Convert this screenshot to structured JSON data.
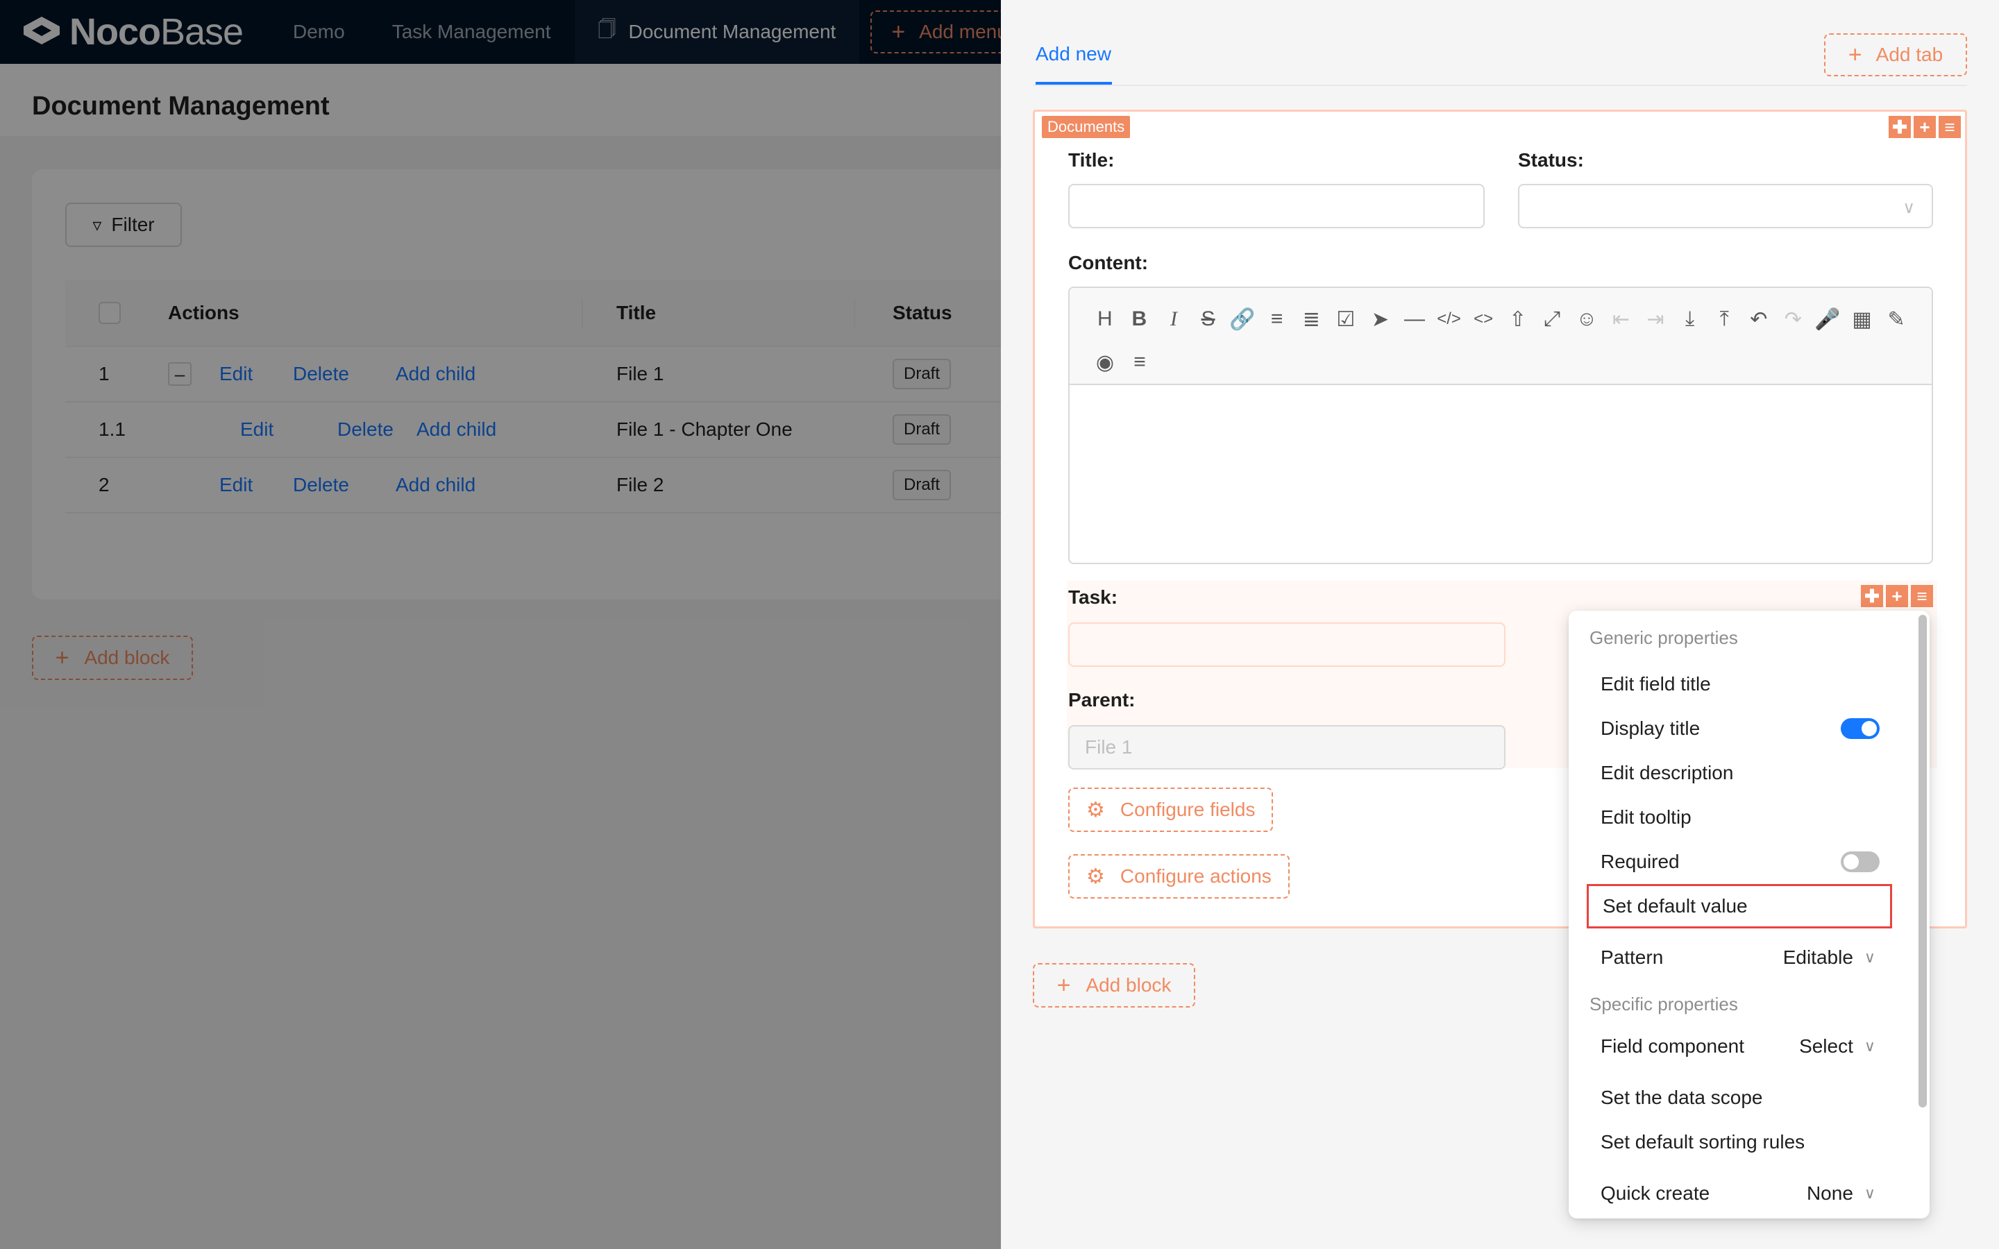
{
  "app": {
    "logo_bold": "Noco",
    "logo_light": "Base",
    "nav": [
      "Demo",
      "Task Management",
      "Document Management"
    ],
    "add_menu": "Add menu"
  },
  "page": {
    "title": "Document Management",
    "filter_label": "Filter",
    "add_block": "Add block"
  },
  "table": {
    "headers": {
      "actions": "Actions",
      "title": "Title",
      "status": "Status"
    },
    "rows": [
      {
        "index": "1",
        "expander": "–",
        "edit": "Edit",
        "delete": "Delete",
        "add_child": "Add child",
        "title": "File 1",
        "status": "Draft"
      },
      {
        "index": "1.1",
        "edit": "Edit",
        "delete": "Delete",
        "add_child": "Add child",
        "title": "File 1 - Chapter One",
        "status": "Draft"
      },
      {
        "index": "2",
        "edit": "Edit",
        "delete": "Delete",
        "add_child": "Add child",
        "title": "File 2",
        "status": "Draft"
      }
    ]
  },
  "drawer": {
    "tab": "Add new",
    "add_tab": "Add tab",
    "block_badge": "Documents",
    "fields": {
      "title": "Title",
      "status": "Status",
      "content": "Content",
      "task": "Task",
      "parent": "Parent",
      "parent_value": "File 1"
    },
    "configure_fields": "Configure fields",
    "configure_actions": "Configure actions",
    "add_block": "Add block"
  },
  "menu": {
    "generic_header": "Generic properties",
    "edit_field_title": "Edit field title",
    "display_title": "Display title",
    "display_title_on": true,
    "edit_description": "Edit description",
    "edit_tooltip": "Edit tooltip",
    "required": "Required",
    "required_on": false,
    "set_default_value": "Set default value",
    "pattern": "Pattern",
    "pattern_value": "Editable",
    "specific_header": "Specific properties",
    "field_component": "Field component",
    "field_component_value": "Select",
    "set_data_scope": "Set the data scope",
    "set_sorting": "Set default sorting rules",
    "quick_create": "Quick create",
    "quick_create_value": "None"
  },
  "colors": {
    "primary": "#1677ff",
    "design_orange": "#f18b62",
    "highlight_red": "#e8443f",
    "nav_bg": "#001529"
  }
}
